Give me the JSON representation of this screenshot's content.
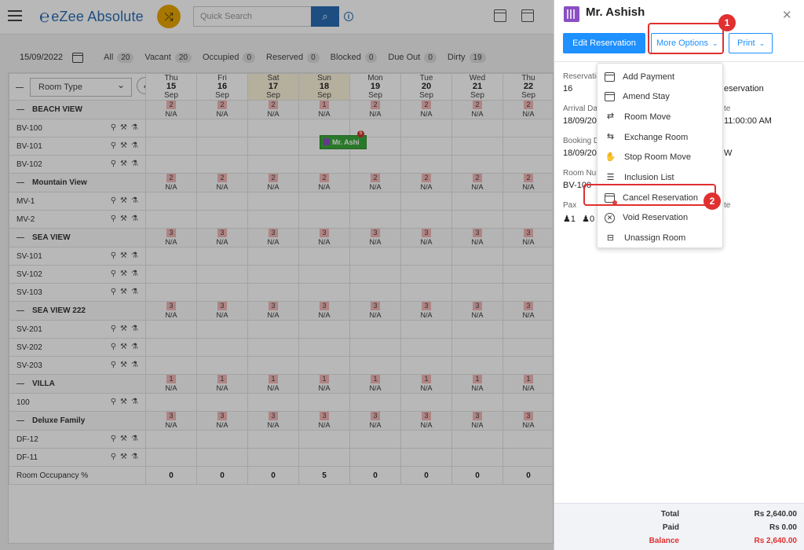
{
  "topbar": {
    "app_name": "eZee Absolute",
    "search_placeholder": "Quick Search"
  },
  "filters": {
    "date": "15/09/2022",
    "stats": [
      {
        "label": "All",
        "count": "20"
      },
      {
        "label": "Vacant",
        "count": "20"
      },
      {
        "label": "Occupied",
        "count": "0"
      },
      {
        "label": "Reserved",
        "count": "0"
      },
      {
        "label": "Blocked",
        "count": "0"
      },
      {
        "label": "Due Out",
        "count": "0"
      },
      {
        "label": "Dirty",
        "count": "19"
      }
    ]
  },
  "grid": {
    "room_type_label": "Room Type",
    "days": [
      {
        "dow": "Thu",
        "date": "15",
        "month": "Sep"
      },
      {
        "dow": "Fri",
        "date": "16",
        "month": "Sep"
      },
      {
        "dow": "Sat",
        "date": "17",
        "month": "Sep"
      },
      {
        "dow": "Sun",
        "date": "18",
        "month": "Sep"
      },
      {
        "dow": "Mon",
        "date": "19",
        "month": "Sep"
      },
      {
        "dow": "Tue",
        "date": "20",
        "month": "Sep"
      },
      {
        "dow": "Wed",
        "date": "21",
        "month": "Sep"
      },
      {
        "dow": "Thu",
        "date": "22",
        "month": "Sep"
      }
    ],
    "na_text": "N/A",
    "groups": [
      {
        "name": "BEACH VIEW",
        "avail": [
          "2",
          "2",
          "2",
          "1",
          "2",
          "2",
          "2",
          "2"
        ],
        "rooms": [
          "BV-100",
          "BV-101",
          "BV-102"
        ]
      },
      {
        "name": "Mountain View",
        "avail": [
          "2",
          "2",
          "2",
          "2",
          "2",
          "2",
          "2",
          "2"
        ],
        "rooms": [
          "MV-1",
          "MV-2"
        ]
      },
      {
        "name": "SEA VIEW",
        "avail": [
          "3",
          "3",
          "3",
          "3",
          "3",
          "3",
          "3",
          "3"
        ],
        "rooms": [
          "SV-101",
          "SV-102",
          "SV-103"
        ]
      },
      {
        "name": "SEA VIEW 222",
        "avail": [
          "3",
          "3",
          "3",
          "3",
          "3",
          "3",
          "3",
          "3"
        ],
        "rooms": [
          "SV-201",
          "SV-202",
          "SV-203"
        ]
      },
      {
        "name": "VILLA",
        "avail": [
          "1",
          "1",
          "1",
          "1",
          "1",
          "1",
          "1",
          "1"
        ],
        "rooms": [
          "100"
        ]
      },
      {
        "name": "Deluxe Family",
        "avail": [
          "3",
          "3",
          "3",
          "3",
          "3",
          "3",
          "3",
          "3"
        ],
        "rooms": [
          "DF-12",
          "DF-11"
        ]
      }
    ],
    "occupancy_label": "Room Occupancy %",
    "occupancy": [
      "0",
      "0",
      "0",
      "5",
      "0",
      "0",
      "0",
      "0"
    ],
    "booking": {
      "label": "Mr. Ashi",
      "badge": "5"
    }
  },
  "panel": {
    "guest_name": "Mr. Ashish",
    "edit_button": "Edit Reservation",
    "more_options_button": "More Options",
    "print_button": "Print",
    "fields": {
      "reservation_label": "Reservation",
      "reservation_value": "16",
      "right_reservation_text": "eservation",
      "arrival_label": "Arrival Dat",
      "arrival_value": "18/09/20",
      "right_label_1": "te",
      "right_time": "11:00:00 AM",
      "booking_label": "Booking Da",
      "booking_value": "18/09/20",
      "right_w": "W",
      "room_num_label": "Room Num",
      "room_num_value": "BV-100",
      "pax_label": "Pax",
      "right_label_2": "te",
      "pax_adults": "1",
      "pax_children": "0"
    },
    "totals": {
      "total_label": "Total",
      "total_value": "Rs 2,640.00",
      "paid_label": "Paid",
      "paid_value": "Rs 0.00",
      "balance_label": "Balance",
      "balance_value": "Rs 2,640.00"
    }
  },
  "dropdown": {
    "items": [
      {
        "label": "Add Payment",
        "icon": "payment-card-icon"
      },
      {
        "label": "Amend Stay",
        "icon": "calendar-edit-icon"
      },
      {
        "label": "Room Move",
        "icon": "bed-move-icon"
      },
      {
        "label": "Exchange Room",
        "icon": "bed-exchange-icon"
      },
      {
        "label": "Stop Room Move",
        "icon": "hand-stop-icon"
      },
      {
        "label": "Inclusion List",
        "icon": "list-plate-icon"
      },
      {
        "label": "Cancel Reservation",
        "icon": "calendar-cancel-icon"
      },
      {
        "label": "Void Reservation",
        "icon": "void-circle-icon"
      },
      {
        "label": "Unassign Room",
        "icon": "bed-unassign-icon"
      }
    ]
  },
  "callouts": {
    "one": "1",
    "two": "2"
  },
  "colors": {
    "accent": "#1e90ff",
    "brand": "#2a6db3",
    "highlight": "#e03030",
    "booking": "#3aa83a"
  }
}
